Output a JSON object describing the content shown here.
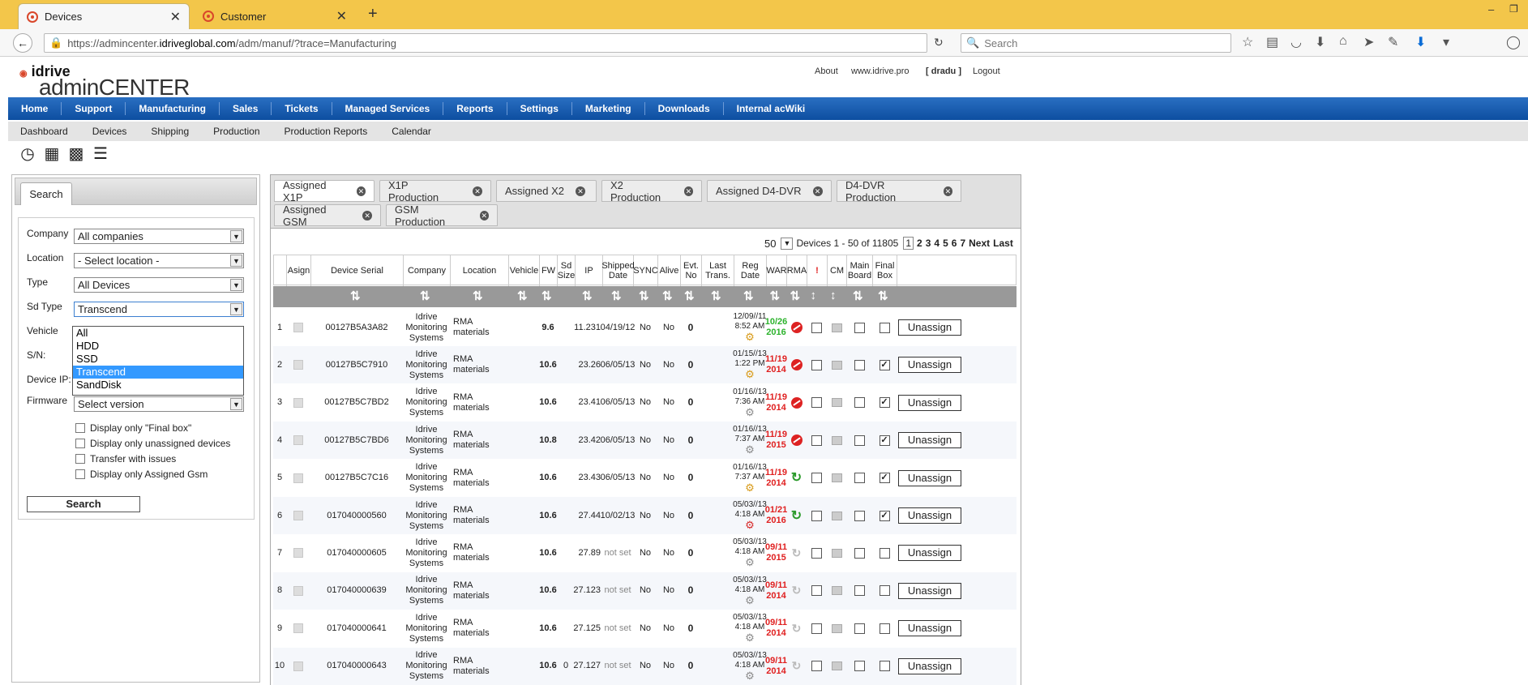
{
  "browser": {
    "tabs": [
      {
        "label": "Devices"
      },
      {
        "label": "Customer"
      }
    ],
    "url_prefix": "https://admincenter.",
    "url_domain": "idriveglobal.com",
    "url_suffix": "/adm/manuf/?trace=Manufacturing",
    "search_placeholder": "Search"
  },
  "site": {
    "logo_top": "idrive",
    "logo_bottom": "adminCENTER",
    "links": {
      "about": "About",
      "website": "www.idrive.pro",
      "user": "[ dradu ]",
      "logout": "Logout"
    }
  },
  "main_menu": [
    "Home",
    "Support",
    "Manufacturing",
    "Sales",
    "Tickets",
    "Managed Services",
    "Reports",
    "Settings",
    "Marketing",
    "Downloads",
    "Internal acWiki"
  ],
  "sub_menu": [
    "Dashboard",
    "Devices",
    "Shipping",
    "Production",
    "Production Reports",
    "Calendar"
  ],
  "search_panel": {
    "tab": "Search",
    "company_label": "Company",
    "company_value": "All companies",
    "location_label": "Location",
    "location_value": "- Select location -",
    "type_label": "Type",
    "type_value": "All Devices",
    "sdtype_label": "Sd Type",
    "sdtype_value": "Transcend",
    "sdtype_options": [
      "All",
      "HDD",
      "SSD",
      "Transcend",
      "SandDisk"
    ],
    "vehicle_label": "Vehicle",
    "sn_label": "S/N:",
    "ip_label": "Device IP:",
    "firmware_label": "Firmware",
    "firmware_value": "Select version",
    "checkboxes": [
      "Display only \"Final box\"",
      "Display only unassigned devices",
      "Transfer with issues",
      "Display only Assigned Gsm"
    ],
    "search_button": "Search"
  },
  "tabs": [
    "Assigned X1P",
    "X1P Production",
    "Assigned X2",
    "X2 Production",
    "Assigned D4-DVR",
    "D4-DVR Production",
    "Assigned GSM",
    "GSM Production"
  ],
  "pager": {
    "per_page": "50",
    "summary": "Devices 1 - 50 of 11805",
    "pages": [
      "1",
      "2",
      "3",
      "4",
      "5",
      "6",
      "7"
    ],
    "next": "Next",
    "last": "Last"
  },
  "columns": [
    "Asign",
    "Device Serial",
    "Company",
    "Location",
    "Vehicle",
    "FW",
    "Sd Size",
    "IP",
    "Shipped Date",
    "SYNC",
    "Alive",
    "Evt. No",
    "Last Trans.",
    "Reg Date",
    "WAR",
    "RMA",
    "!",
    "CM",
    "Main Board",
    "Final Box"
  ],
  "rows": [
    {
      "n": "1",
      "serial": "00127B5A3A82",
      "company": "Idrive Monitoring Systems",
      "location": "RMA materials",
      "vehicle": "",
      "fw": "9.6",
      "sd": "",
      "ip": "11.231",
      "shipped": "04/19/12",
      "sync": "No",
      "alive": "No",
      "evt": "0",
      "reg_date": "12/09//11",
      "reg_time": "8:52 AM",
      "gear": "orange",
      "war": "10/26 2016",
      "war_color": "#2db32d",
      "rma": "red",
      "main": false,
      "final": false,
      "action": "Unassign"
    },
    {
      "n": "2",
      "serial": "00127B5C7910",
      "company": "Idrive Monitoring Systems",
      "location": "RMA materials",
      "vehicle": "",
      "fw": "10.6",
      "sd": "",
      "ip": "23.26",
      "shipped": "06/05/13",
      "sync": "No",
      "alive": "No",
      "evt": "0",
      "reg_date": "01/15//13",
      "reg_time": "1:22 PM",
      "gear": "orange",
      "war": "11/19 2014",
      "war_color": "#e02020",
      "rma": "red",
      "main": false,
      "final": true,
      "action": "Unassign"
    },
    {
      "n": "3",
      "serial": "00127B5C7BD2",
      "company": "Idrive Monitoring Systems",
      "location": "RMA materials",
      "vehicle": "",
      "fw": "10.6",
      "sd": "",
      "ip": "23.41",
      "shipped": "06/05/13",
      "sync": "No",
      "alive": "No",
      "evt": "0",
      "reg_date": "01/16//13",
      "reg_time": "7:36 AM",
      "gear": "grey",
      "war": "11/19 2014",
      "war_color": "#e02020",
      "rma": "red",
      "main": false,
      "final": true,
      "action": "Unassign"
    },
    {
      "n": "4",
      "serial": "00127B5C7BD6",
      "company": "Idrive Monitoring Systems",
      "location": "RMA materials",
      "vehicle": "",
      "fw": "10.8",
      "sd": "",
      "ip": "23.42",
      "shipped": "06/05/13",
      "sync": "No",
      "alive": "No",
      "evt": "0",
      "reg_date": "01/16//13",
      "reg_time": "7:37 AM",
      "gear": "grey",
      "war": "11/19 2015",
      "war_color": "#e02020",
      "rma": "red",
      "main": false,
      "final": true,
      "action": "Unassign"
    },
    {
      "n": "5",
      "serial": "00127B5C7C16",
      "company": "Idrive Monitoring Systems",
      "location": "RMA materials",
      "vehicle": "",
      "fw": "10.6",
      "sd": "",
      "ip": "23.43",
      "shipped": "06/05/13",
      "sync": "No",
      "alive": "No",
      "evt": "0",
      "reg_date": "01/16//13",
      "reg_time": "7:37 AM",
      "gear": "orange",
      "war": "11/19 2014",
      "war_color": "#e02020",
      "rma": "green",
      "main": false,
      "final": true,
      "action": "Unassign"
    },
    {
      "n": "6",
      "serial": "017040000560",
      "company": "Idrive Monitoring Systems",
      "location": "RMA materials",
      "vehicle": "",
      "fw": "10.6",
      "sd": "",
      "ip": "27.44",
      "shipped": "10/02/13",
      "sync": "No",
      "alive": "No",
      "evt": "0",
      "reg_date": "05/03//13",
      "reg_time": "4:18 AM",
      "gear": "red",
      "war": "01/21 2016",
      "war_color": "#e02020",
      "rma": "green",
      "main": false,
      "final": true,
      "action": "Unassign"
    },
    {
      "n": "7",
      "serial": "017040000605",
      "company": "Idrive Monitoring Systems",
      "location": "RMA materials",
      "vehicle": "",
      "fw": "10.6",
      "sd": "",
      "ip": "27.89",
      "shipped": "not set",
      "sync": "No",
      "alive": "No",
      "evt": "0",
      "reg_date": "05/03//13",
      "reg_time": "4:18 AM",
      "gear": "grey",
      "war": "09/11 2015",
      "war_color": "#e02020",
      "rma": "grey",
      "main": false,
      "final": false,
      "action": "Unassign"
    },
    {
      "n": "8",
      "serial": "017040000639",
      "company": "Idrive Monitoring Systems",
      "location": "RMA materials",
      "vehicle": "",
      "fw": "10.6",
      "sd": "",
      "ip": "27.123",
      "shipped": "not set",
      "sync": "No",
      "alive": "No",
      "evt": "0",
      "reg_date": "05/03//13",
      "reg_time": "4:18 AM",
      "gear": "grey",
      "war": "09/11 2014",
      "war_color": "#e02020",
      "rma": "grey",
      "main": false,
      "final": false,
      "action": "Unassign"
    },
    {
      "n": "9",
      "serial": "017040000641",
      "company": "Idrive Monitoring Systems",
      "location": "RMA materials",
      "vehicle": "",
      "fw": "10.6",
      "sd": "",
      "ip": "27.125",
      "shipped": "not set",
      "sync": "No",
      "alive": "No",
      "evt": "0",
      "reg_date": "05/03//13",
      "reg_time": "4:18 AM",
      "gear": "grey",
      "war": "09/11 2014",
      "war_color": "#e02020",
      "rma": "grey",
      "main": false,
      "final": false,
      "action": "Unassign"
    },
    {
      "n": "10",
      "serial": "017040000643",
      "company": "Idrive Monitoring Systems",
      "location": "RMA materials",
      "vehicle": "",
      "fw": "10.6",
      "sd": "0",
      "ip": "27.127",
      "shipped": "not set",
      "sync": "No",
      "alive": "No",
      "evt": "0",
      "reg_date": "05/03//13",
      "reg_time": "4:18 AM",
      "gear": "grey",
      "war": "09/11 2014",
      "war_color": "#e02020",
      "rma": "grey",
      "main": false,
      "final": false,
      "action": "Unassign"
    }
  ]
}
